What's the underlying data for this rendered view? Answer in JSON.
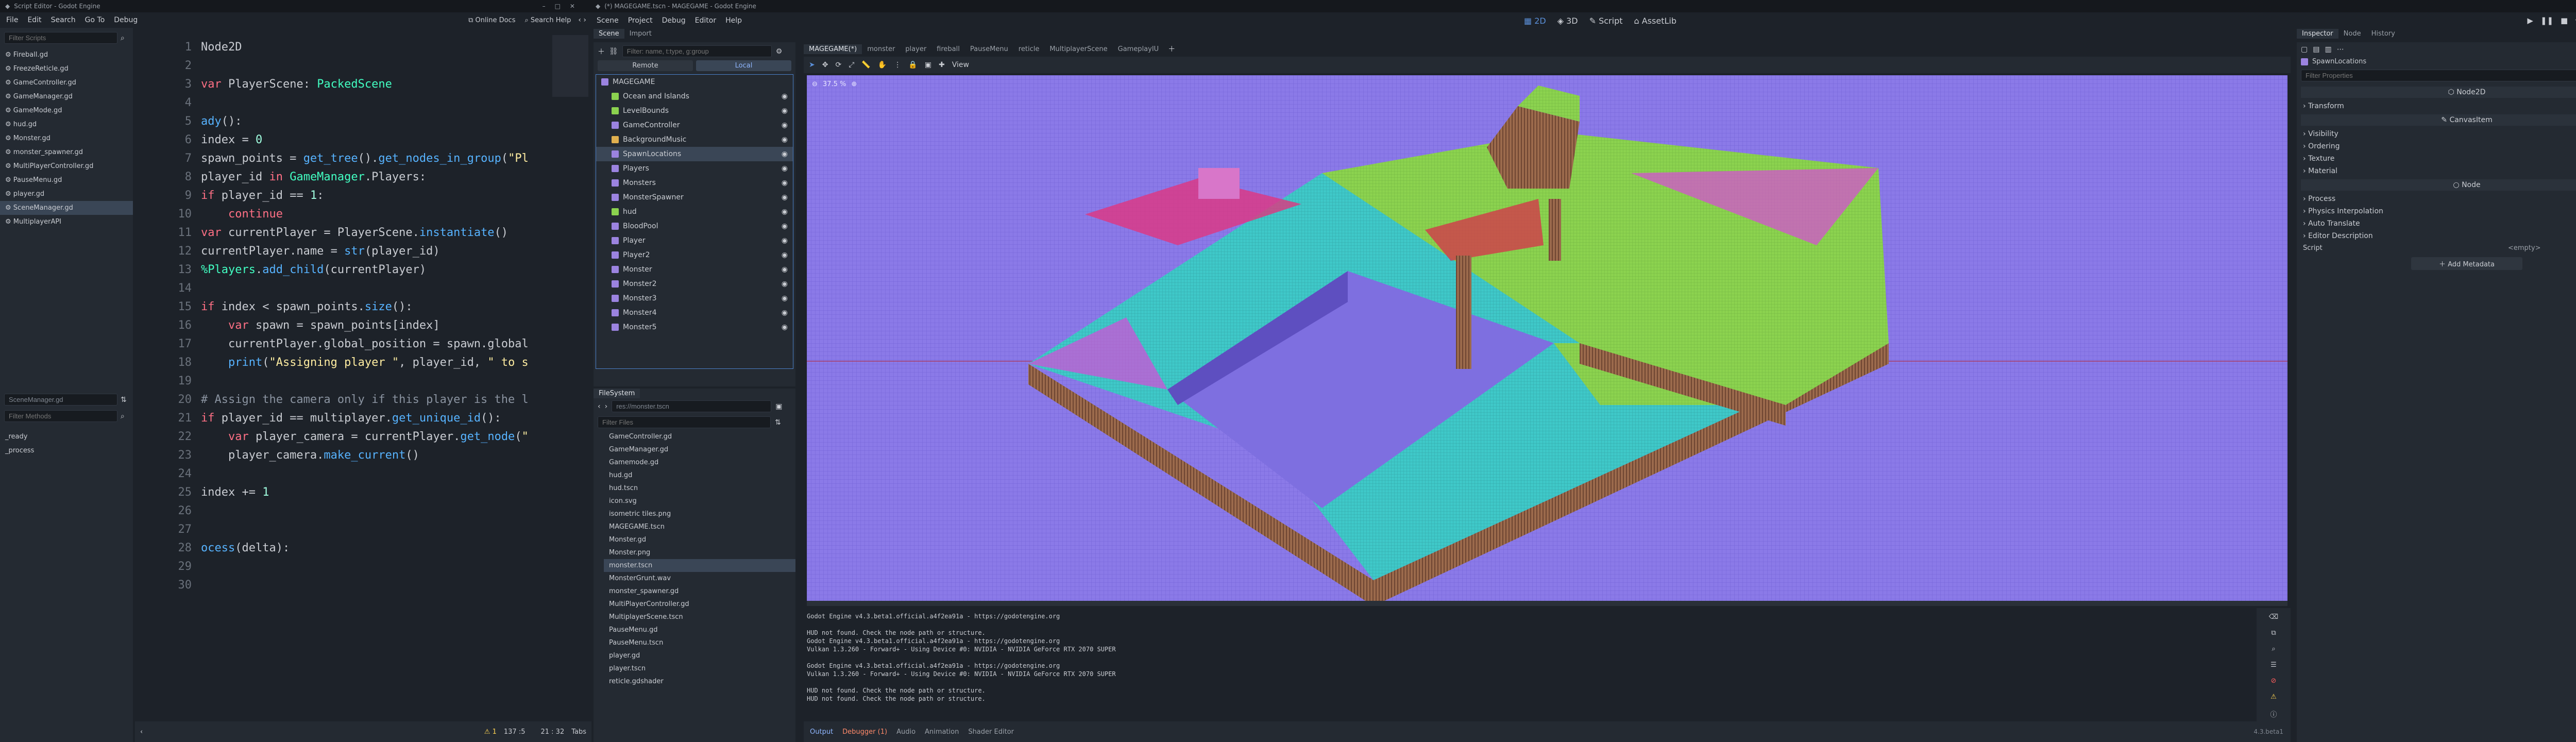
{
  "script_window": {
    "title": "Script Editor - Godot Engine",
    "menu": [
      "File",
      "Edit",
      "Search",
      "Go To",
      "Debug"
    ],
    "online_docs": "Online Docs",
    "search_help": "Search Help",
    "filter_scripts_placeholder": "Filter Scripts",
    "scripts": [
      "Fireball.gd",
      "FreezeReticle.gd",
      "GameController.gd",
      "GameManager.gd",
      "GameMode.gd",
      "hud.gd",
      "Monster.gd",
      "monster_spawner.gd",
      "MultiPlayerController.gd",
      "PauseMenu.gd",
      "player.gd",
      "SceneManager.gd",
      "MultiplayerAPI"
    ],
    "selected_script_index": 11,
    "current_script": "SceneManager.gd",
    "filter_methods_placeholder": "Filter Methods",
    "methods": [
      "_ready",
      "_process"
    ],
    "status": {
      "warnings": "1",
      "position": "137 :5",
      "line_col": "21 : 32",
      "tabs": "Tabs"
    }
  },
  "code_lines": [
    {
      "n": "1",
      "html": "Node2D"
    },
    {
      "n": "2",
      "html": ""
    },
    {
      "n": "3",
      "html": "<span class='kw'>var</span> PlayerScene: <span class='ty'>PackedScene</span>"
    },
    {
      "n": "4",
      "html": ""
    },
    {
      "n": "5",
      "html": "<span class='fn'>ady</span>():"
    },
    {
      "n": "6",
      "html": "index = <span class='nm'>0</span>"
    },
    {
      "n": "7",
      "html": "spawn_points = <span class='fn'>get_tree</span>().<span class='fn'>get_nodes_in_group</span>(<span class='st'>\"Pl</span>"
    },
    {
      "n": "8",
      "html": "player_id <span class='kw'>in</span> <span class='ty'>GameManager</span>.Players:"
    },
    {
      "n": "9",
      "html": "<span class='kw'>if</span> player_id == <span class='nm'>1</span>:"
    },
    {
      "n": "10",
      "html": "    <span class='kw'>continue</span>"
    },
    {
      "n": "11",
      "html": "<span class='kw'>var</span> currentPlayer = PlayerScene.<span class='fn'>instantiate</span>()"
    },
    {
      "n": "12",
      "html": "currentPlayer.name = <span class='fn'>str</span>(player_id)"
    },
    {
      "n": "13",
      "html": "<span class='ty'>%Players</span>.<span class='fn'>add_child</span>(currentPlayer)"
    },
    {
      "n": "14",
      "html": ""
    },
    {
      "n": "15",
      "html": "<span class='kw'>if</span> index &lt; spawn_points.<span class='fn'>size</span>():"
    },
    {
      "n": "16",
      "html": "    <span class='kw'>var</span> spawn = spawn_points[index]"
    },
    {
      "n": "17",
      "html": "    currentPlayer.global_position = spawn.global"
    },
    {
      "n": "18",
      "html": "    <span class='fn'>print</span>(<span class='st'>\"Assigning player \"</span>, player_id, <span class='st'>\" to s</span>"
    },
    {
      "n": "19",
      "html": ""
    },
    {
      "n": "20",
      "html": "<span class='cm'># Assign the camera only if this player is the l</span>"
    },
    {
      "n": "21",
      "html": "<span class='kw'>if</span> player_id == multiplayer.<span class='fn'>get_unique_id</span>():"
    },
    {
      "n": "22",
      "html": "    <span class='kw'>var</span> player_camera = currentPlayer.<span class='fn'>get_node</span>(<span class='st'>\"</span>"
    },
    {
      "n": "23",
      "html": "    player_camera.<span class='fn'>make_current</span>()"
    },
    {
      "n": "24",
      "html": ""
    },
    {
      "n": "25",
      "html": "index += <span class='nm'>1</span>"
    },
    {
      "n": "26",
      "html": ""
    },
    {
      "n": "27",
      "html": ""
    },
    {
      "n": "28",
      "html": "<span class='fn'>ocess</span>(delta):"
    },
    {
      "n": "29",
      "html": ""
    },
    {
      "n": "30",
      "html": ""
    }
  ],
  "godot_window": {
    "title": "(*) MAGEGAME.tscn - MAGEGAME - Godot Engine",
    "menu": [
      "Scene",
      "Project",
      "Debug",
      "Editor",
      "Help"
    ],
    "modes": [
      "2D",
      "3D",
      "Script",
      "AssetLib"
    ],
    "scene_tabs": [
      "Scene",
      "Import"
    ],
    "remote": "Remote",
    "local": "Local",
    "filter_nodes_placeholder": "Filter: name, t:type, g:group",
    "root": "MAGEGAME",
    "nodes": [
      "Ocean and Islands",
      "LevelBounds",
      "GameController",
      "BackgroundMusic",
      "SpawnLocations",
      "Players",
      "Monsters",
      "MonsterSpawner",
      "hud",
      "BloodPool",
      "Player",
      "Player2",
      "Monster",
      "Monster2",
      "Monster3",
      "Monster4",
      "Monster5"
    ],
    "selected_node_index": 4,
    "filesystem_tab": "FileSystem",
    "res_path": "res://monster.tscn",
    "filter_files_placeholder": "Filter Files",
    "files": [
      "GameController.gd",
      "GameManager.gd",
      "Gamemode.gd",
      "hud.gd",
      "hud.tscn",
      "icon.svg",
      "isometric tiles.png",
      "MAGEGAME.tscn",
      "Monster.gd",
      "Monster.png",
      "monster.tscn",
      "MonsterGrunt.wav",
      "monster_spawner.gd",
      "MultiPlayerController.gd",
      "MultiplayerScene.tscn",
      "PauseMenu.gd",
      "PauseMenu.tscn",
      "player.gd",
      "player.tscn",
      "reticle.gdshader"
    ],
    "selected_file_index": 10,
    "editor_tabs": [
      "MAGEGAME(*)",
      "monster",
      "player",
      "fireball",
      "PauseMenu",
      "reticle",
      "MultiplayerScene",
      "GameplayIU"
    ],
    "zoom": "37.5 %",
    "view_label": "View",
    "output_lines": [
      "Godot Engine v4.3.beta1.official.a4f2ea91a - https://godotengine.org",
      "",
      "HUD not found. Check the node path or structure.",
      "Godot Engine v4.3.beta1.official.a4f2ea91a - https://godotengine.org",
      "Vulkan 1.3.260 - Forward+ - Using Device #0: NVIDIA - NVIDIA GeForce RTX 2070 SUPER",
      "",
      "Godot Engine v4.3.beta1.official.a4f2ea91a - https://godotengine.org",
      "Vulkan 1.3.260 - Forward+ - Using Device #0: NVIDIA - NVIDIA GeForce RTX 2070 SUPER",
      "",
      "HUD not found. Check the node path or structure.",
      "HUD not found. Check the node path or structure."
    ],
    "bottom_tabs": [
      "Output",
      "Debugger (1)",
      "Audio",
      "Animation",
      "Shader Editor"
    ],
    "version": "4.3.beta1",
    "inspector_tabs": [
      "Inspector",
      "Node",
      "History"
    ],
    "inspected_node": "SpawnLocations",
    "filter_properties_placeholder": "Filter Properties",
    "class_node2d": "Node2D",
    "node2d_sections": [
      "Transform"
    ],
    "class_canvas": "CanvasItem",
    "canvas_sections": [
      "Visibility",
      "Ordering",
      "Texture",
      "Material"
    ],
    "class_node": "Node",
    "node_sections": [
      "Process",
      "Physics Interpolation",
      "Auto Translate",
      "Editor Description"
    ],
    "script_label": "Script",
    "script_value": "<empty>",
    "add_metadata": "Add Metadata"
  },
  "colors": {
    "accent": "#5a8fd8",
    "bg": "#1d2229",
    "panel": "#242a32",
    "viewport": "#7e6fe0"
  }
}
